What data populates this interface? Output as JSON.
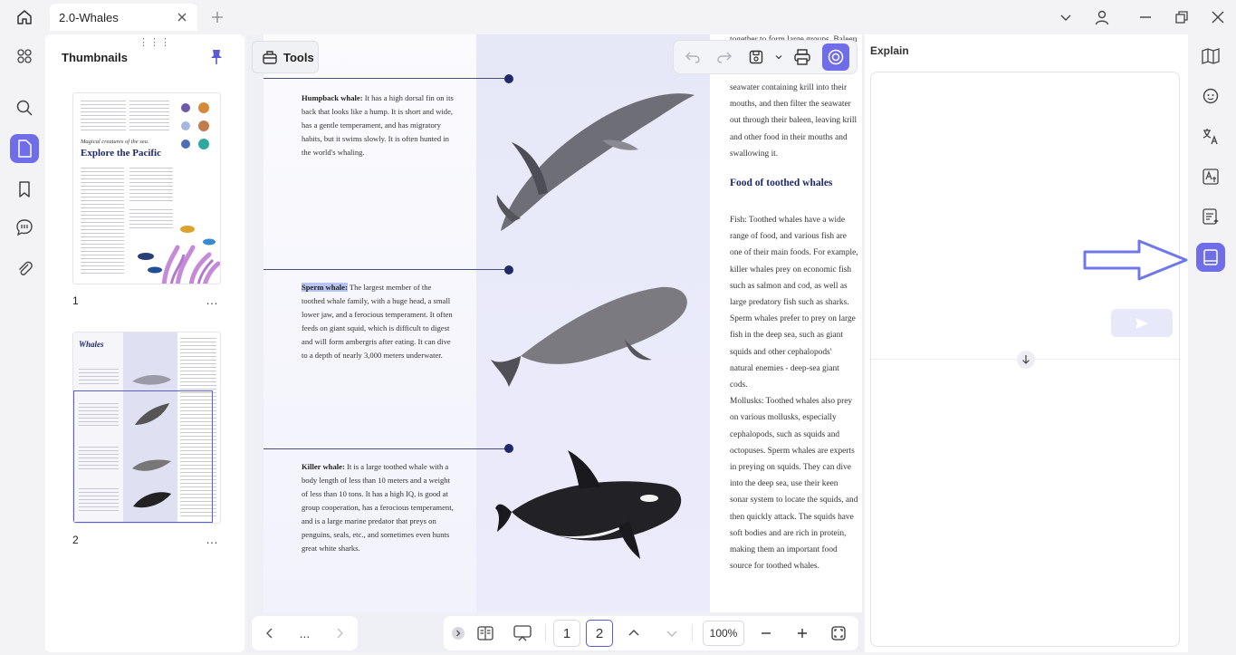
{
  "tab": {
    "title": "2.0-Whales"
  },
  "thumbnails": {
    "title": "Thumbnails",
    "pages": [
      {
        "number": "1",
        "menu": "…",
        "heading_italic": "Magical creatures of the sea.",
        "heading": "Explore the Pacific"
      },
      {
        "number": "2",
        "menu": "…",
        "heading": "Whales"
      }
    ]
  },
  "tools": {
    "label": "Tools"
  },
  "document": {
    "whales": [
      {
        "name": "Humpback whale:",
        "text": " It has a high dorsal fin on its back that looks like a hump. It is short and wide, has a gentle temperament, and has migratory habits, but it swims slowly. It is often hunted in the world's whaling."
      },
      {
        "name": "Sperm whale:",
        "text": " The largest member of the toothed whale family, with a huge head, a small lower jaw, and a ferocious temperament. It often feeds on giant squid, which is difficult to digest and will form ambergris after eating. It can dive to a depth of nearly 3,000 meters underwater."
      },
      {
        "name": "Killer whale:",
        "text": " It is a large toothed whale with a body length of less than 10 meters and a weight of less than 10 tons. It has a high IQ, is good at group cooperation, has a ferocious temperament, and is a large marine predator that preys on penguins, seals, etc., and sometimes even hunts great white sharks."
      }
    ],
    "right_top_cut": "together to form large groups. Baleen",
    "right_top": "seawater containing krill into their\nmouths, and then filter the seawater\nout through their baleen, leaving krill\nand other food in their mouths and\nswallowing it.",
    "right_heading": "Food of toothed whales",
    "right_body": "Fish: Toothed whales have a wide\nrange of food, and various fish are\none of their main foods. For example,\nkiller whales prey on economic fish\nsuch as salmon and cod, as well as\nlarge predatory fish such as sharks.\nSperm whales prefer to prey on large\nfish in the deep sea, such as giant\nsquids and other cephalopods'\nnatural enemies - deep-sea giant\ncods.\nMollusks: Toothed whales also prey\non various mollusks, especially\ncephalopods, such as squids and\noctopuses. Sperm whales are experts\nin preying on squids. They can dive\ninto the deep sea, use their keen\nsonar system to locate the squids, and\nthen quickly attack. The squids have\nsoft bodies and are rich in protein,\nmaking them an important food\nsource for toothed whales."
  },
  "bottom": {
    "nav_more": "...",
    "page1": "1",
    "page2": "2",
    "zoom": "100%"
  },
  "explain": {
    "title": "Explain"
  },
  "colors": {
    "accent": "#6f6ee8",
    "heading": "#1f2a6b",
    "arrow": "#6f78e8"
  }
}
